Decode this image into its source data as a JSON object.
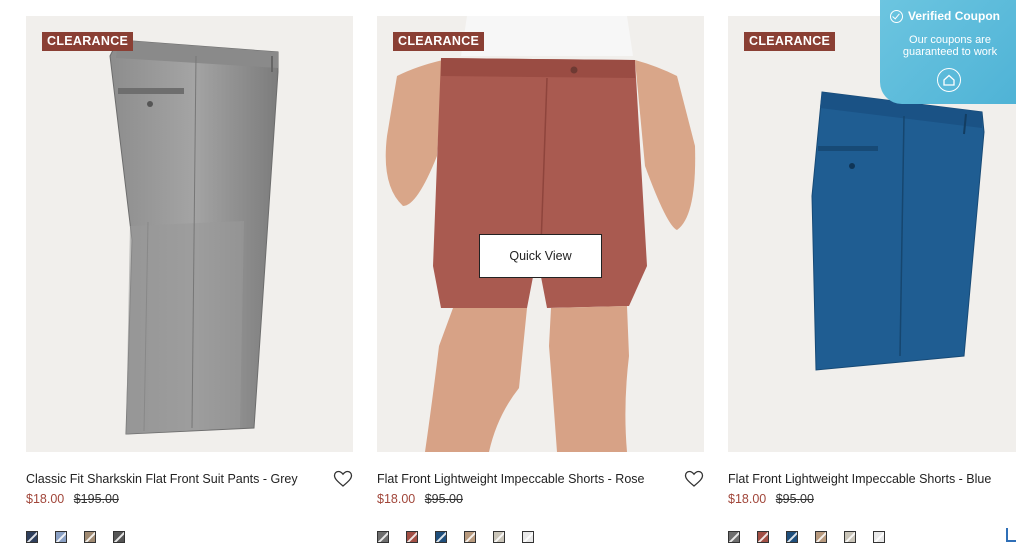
{
  "products": [
    {
      "badge": "CLEARANCE",
      "title": "Classic Fit Sharkskin Flat Front Suit Pants - Grey",
      "sale_price": "$18.00",
      "original_price": "$195.00",
      "swatches": [
        "#2f3f5c",
        "#8aa0c4",
        "#a08a72",
        "#555555"
      ]
    },
    {
      "badge": "CLEARANCE",
      "title": "Flat Front Lightweight Impeccable Shorts - Rose",
      "sale_price": "$18.00",
      "original_price": "$95.00",
      "quick_view": "Quick View",
      "swatches": [
        "#6e6e6e",
        "#a24f45",
        "#1f4f7c",
        "#b89a7e",
        "#c9c4b8",
        "#e8e8e8"
      ]
    },
    {
      "badge": "CLEARANCE",
      "title": "Flat Front Lightweight Impeccable Shorts - Blue",
      "sale_price": "$18.00",
      "original_price": "$95.00",
      "swatches": [
        "#6e6e6e",
        "#a24f45",
        "#1f4f7c",
        "#b89a7e",
        "#c9c4b8",
        "#e8e8e8"
      ]
    }
  ],
  "coupon": {
    "title": "Verified Coupon",
    "text": "Our coupons are guaranteed to work"
  },
  "colors": {
    "badge": "#8a3f34",
    "sale_price": "#a1463a",
    "coupon": "#5bbbdb"
  }
}
